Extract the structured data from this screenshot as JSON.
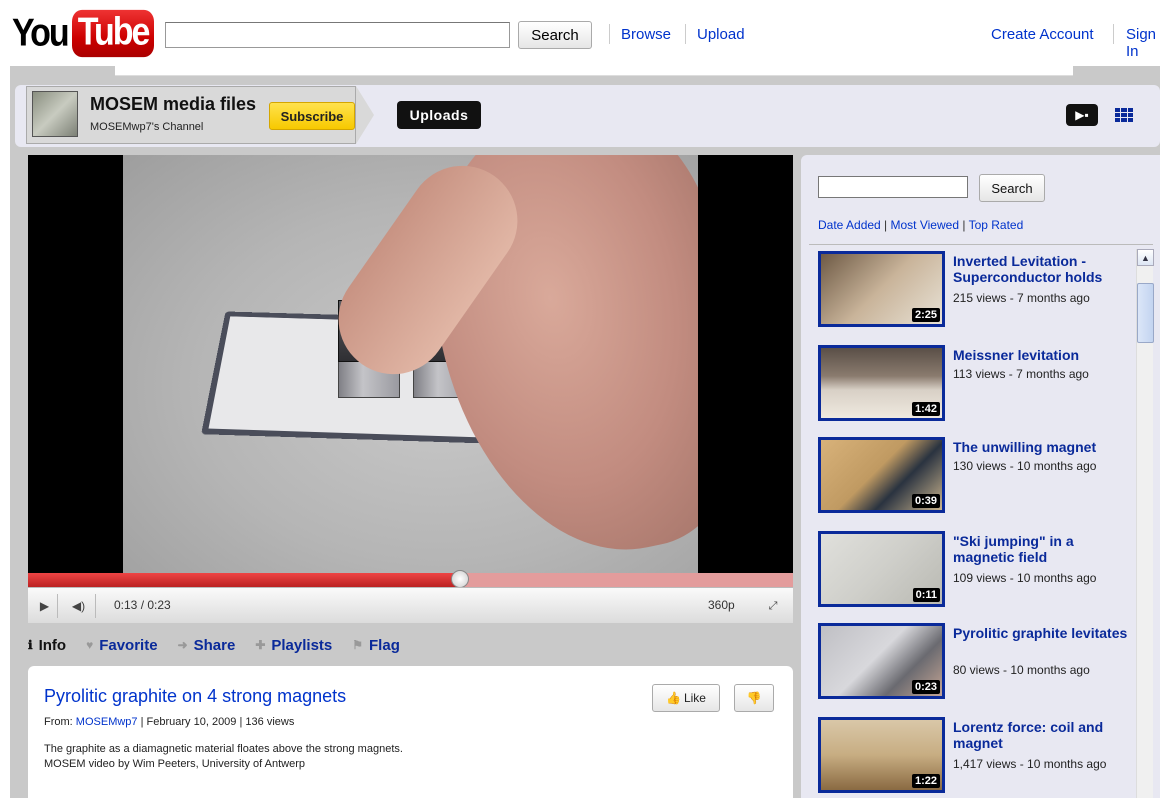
{
  "header": {
    "logo_you": "You",
    "logo_tube": "Tube",
    "search_value": "",
    "search_label": "Search",
    "browse": "Browse",
    "upload": "Upload",
    "create_account": "Create Account",
    "sign_in": "Sign In"
  },
  "channel": {
    "title": "MOSEM media files",
    "subtitle": "MOSEMwp7's Channel",
    "subscribe": "Subscribe",
    "uploads_tab": "Uploads"
  },
  "player": {
    "current_time": "0:13",
    "total_time": "0:23",
    "time_display": "0:13 / 0:23",
    "quality": "360p",
    "progress_fraction": 0.5652
  },
  "tabs": [
    {
      "label": "Info",
      "icon": "info-icon",
      "active": true
    },
    {
      "label": "Favorite",
      "icon": "heart-icon",
      "active": false
    },
    {
      "label": "Share",
      "icon": "share-arrow-icon",
      "active": false
    },
    {
      "label": "Playlists",
      "icon": "plus-icon",
      "active": false
    },
    {
      "label": "Flag",
      "icon": "flag-icon",
      "active": false
    }
  ],
  "video": {
    "title": "Pyrolitic graphite on 4 strong magnets",
    "from_label": "From:",
    "uploader": "MOSEMwp7",
    "date": "February 10, 2009",
    "views": "136 views",
    "description_line1": "The graphite as a diamagnetic material floates above the strong magnets.",
    "description_line2": "MOSEM video by Wim Peeters, University of Antwerp",
    "like_label": "Like"
  },
  "sidebar": {
    "search_value": "",
    "search_label": "Search",
    "sort_date": "Date Added",
    "sort_viewed": "Most Viewed",
    "sort_rated": "Top Rated",
    "videos": [
      {
        "title": "Inverted Levitation - Superconductor holds",
        "meta": "215 views - 7 months ago",
        "duration": "2:25"
      },
      {
        "title": "Meissner levitation",
        "meta": "113 views - 7 months ago",
        "duration": "1:42"
      },
      {
        "title": "The unwilling magnet",
        "meta": "130 views - 10 months ago",
        "duration": "0:39"
      },
      {
        "title": "\"Ski jumping\" in a magnetic field",
        "meta": "109 views - 10 months ago",
        "duration": "0:11"
      },
      {
        "title": "Pyrolitic graphite levitates",
        "meta": "80 views - 10 months ago",
        "duration": "0:23"
      },
      {
        "title": "Lorentz force: coil and magnet",
        "meta": "1,417 views - 10 months ago",
        "duration": "1:22"
      }
    ]
  },
  "colors": {
    "link": "#0033cc",
    "subscribe_bg": "#f7c900",
    "progress_red": "#cc2222",
    "panel_bg": "#e8e8f2"
  }
}
